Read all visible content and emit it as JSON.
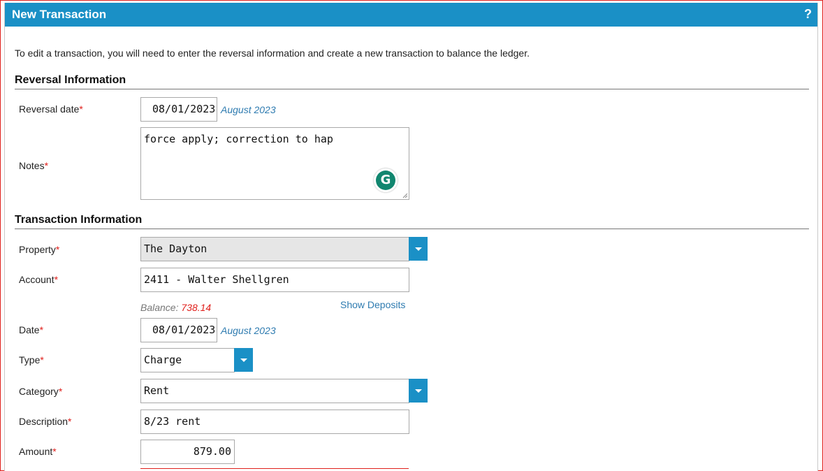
{
  "header": {
    "title": "New Transaction",
    "help": "?"
  },
  "intro": "To edit a transaction, you will need to enter the reversal information and create a new transaction to balance the ledger.",
  "reversal": {
    "section_title": "Reversal Information",
    "date_label": "Reversal date",
    "date_value": "08/01/2023",
    "date_month": "August 2023",
    "notes_label": "Notes",
    "notes_value": "force apply; correction to hap",
    "grammarly_letter": "G"
  },
  "transaction": {
    "section_title": "Transaction Information",
    "property_label": "Property",
    "property_value": "The Dayton",
    "account_label": "Account",
    "account_value": "2411 - Walter Shellgren",
    "balance_label": "Balance:",
    "balance_value": "738.14",
    "show_deposits": "Show Deposits",
    "date_label": "Date",
    "date_value": "08/01/2023",
    "date_month": "August 2023",
    "type_label": "Type",
    "type_value": "Charge",
    "category_label": "Category",
    "category_value": "Rent",
    "description_label": "Description",
    "description_value": "8/23 rent",
    "amount_label": "Amount",
    "amount_value": "879.00"
  },
  "required_mark": "*",
  "colors": {
    "accent": "#1a90c6",
    "required": "#e0201c",
    "link": "#2e7bb0",
    "grammarly": "#11866f"
  }
}
